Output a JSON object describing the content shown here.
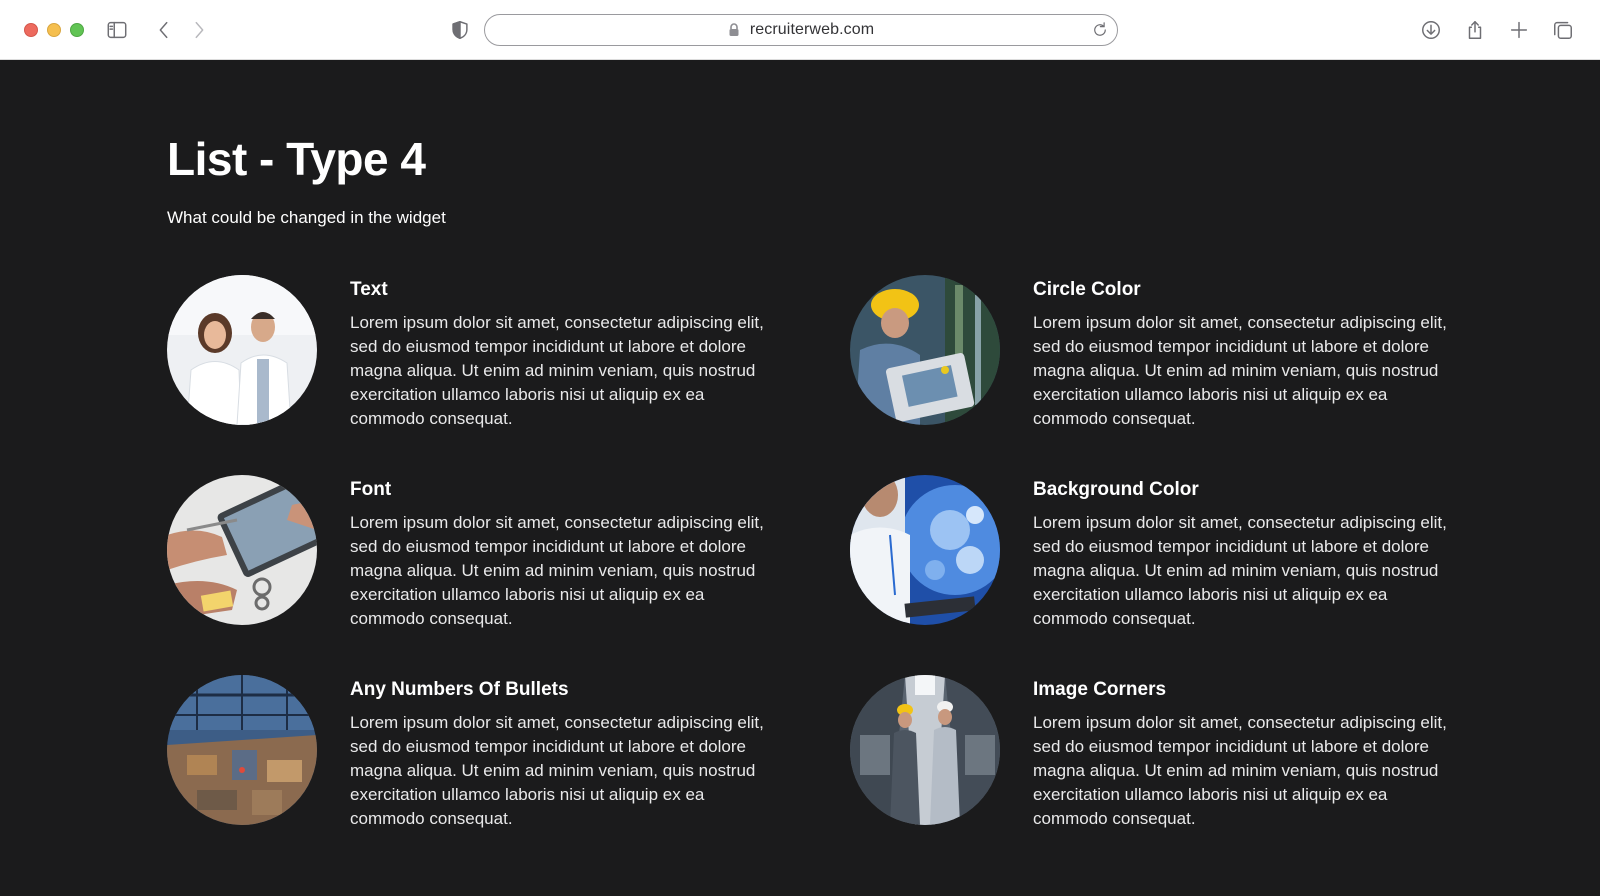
{
  "browser": {
    "url": "recruiterweb.com",
    "icons": {
      "sidebar": "sidebar-icon",
      "back": "chevron-left-icon",
      "forward": "chevron-right-icon",
      "privacy": "shield-icon",
      "lock": "lock-icon",
      "reload": "reload-icon",
      "download": "download-icon",
      "share": "share-icon",
      "new_tab": "plus-icon",
      "tabs": "tabs-overview-icon"
    }
  },
  "page": {
    "title": "List - Type 4",
    "subtitle": "What could be changed in the widget"
  },
  "items": [
    {
      "title": "Text",
      "body": "Lorem ipsum dolor sit amet, consectetur adipiscing elit, sed do eiusmod tempor incididunt ut labore et dolore magna aliqua. Ut enim ad minim veniam, quis nostrud exercitation ullamco laboris nisi ut aliquip ex ea commodo consequat."
    },
    {
      "title": "Circle Color",
      "body": "Lorem ipsum dolor sit amet, consectetur adipiscing elit, sed do eiusmod tempor incididunt ut labore et dolore magna aliqua. Ut enim ad minim veniam, quis nostrud exercitation ullamco laboris nisi ut aliquip ex ea commodo consequat."
    },
    {
      "title": "Font",
      "body": "Lorem ipsum dolor sit amet, consectetur adipiscing elit, sed do eiusmod tempor incididunt ut labore et dolore magna aliqua. Ut enim ad minim veniam, quis nostrud exercitation ullamco laboris nisi ut aliquip ex ea commodo consequat."
    },
    {
      "title": "Background Color",
      "body": "Lorem ipsum dolor sit amet, consectetur adipiscing elit, sed do eiusmod tempor incididunt ut labore et dolore magna aliqua. Ut enim ad minim veniam, quis nostrud exercitation ullamco laboris nisi ut aliquip ex ea commodo consequat."
    },
    {
      "title": "Any Numbers Of Bullets",
      "body": "Lorem ipsum dolor sit amet, consectetur adipiscing elit, sed do eiusmod tempor incididunt ut labore et dolore magna aliqua. Ut enim ad minim veniam, quis nostrud exercitation ullamco laboris nisi ut aliquip ex ea commodo consequat."
    },
    {
      "title": "Image Corners",
      "body": "Lorem ipsum dolor sit amet, consectetur adipiscing elit, sed do eiusmod tempor incididunt ut labore et dolore magna aliqua. Ut enim ad minim veniam, quis nostrud exercitation ullamco laboris nisi ut aliquip ex ea commodo consequat."
    }
  ],
  "colors": {
    "page_background": "#1b1b1c",
    "text": "#ffffff",
    "chrome_background": "#ffffff"
  }
}
